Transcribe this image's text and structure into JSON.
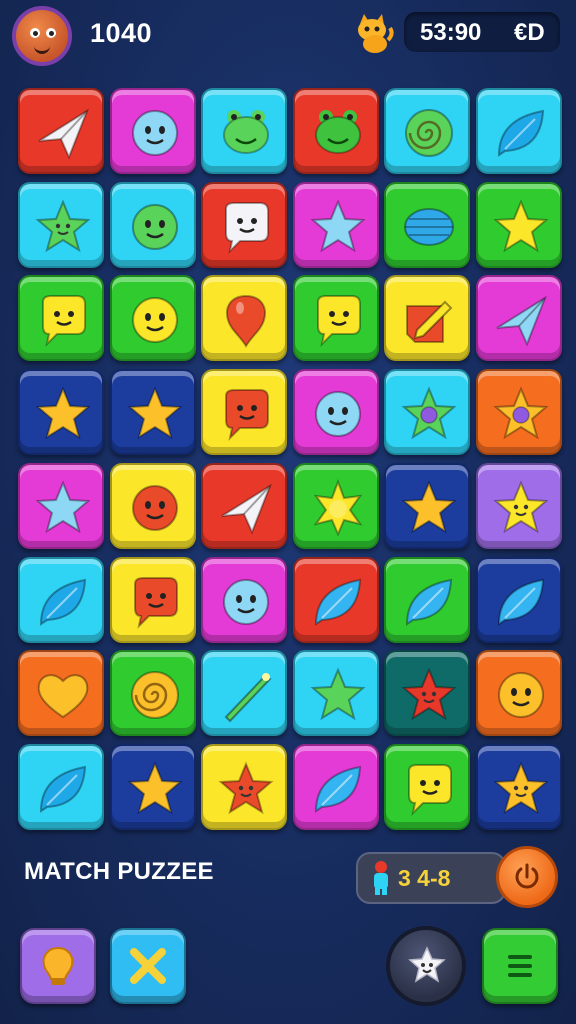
{
  "hud": {
    "score": "1040",
    "timer": "53:90",
    "currency": "€D"
  },
  "footer": {
    "title": "MATCH PUZZEE",
    "level_text": "3 4-8"
  },
  "colors": {
    "red": "#e8382a",
    "magenta": "#e43ad6",
    "cyan": "#2fd3f3",
    "green": "#2fcb2f",
    "yellow": "#fbe62a",
    "navy": "#1c3d9e",
    "orange": "#f56d1f",
    "purple": "#9f6de8",
    "teal": "#0e6b68"
  },
  "board": {
    "rows": [
      [
        {
          "color": "red",
          "icon": "paper-plane-icon"
        },
        {
          "color": "magenta",
          "icon": "smiley-blob-icon"
        },
        {
          "color": "cyan",
          "icon": "frog-icon"
        },
        {
          "color": "red",
          "icon": "frog-icon"
        },
        {
          "color": "cyan",
          "icon": "swirl-icon"
        },
        {
          "color": "cyan",
          "icon": "leaf-drop-icon"
        }
      ],
      [
        {
          "color": "cyan",
          "icon": "star-face-icon"
        },
        {
          "color": "cyan",
          "icon": "smiley-blob-icon"
        },
        {
          "color": "red",
          "icon": "speech-face-icon"
        },
        {
          "color": "magenta",
          "icon": "star-icon"
        },
        {
          "color": "green",
          "icon": "ball-icon"
        },
        {
          "color": "green",
          "icon": "star-icon"
        }
      ],
      [
        {
          "color": "green",
          "icon": "speech-face-icon"
        },
        {
          "color": "green",
          "icon": "smiley-blob-icon"
        },
        {
          "color": "yellow",
          "icon": "balloon-icon"
        },
        {
          "color": "green",
          "icon": "speech-face-icon"
        },
        {
          "color": "yellow",
          "icon": "pencil-icon"
        },
        {
          "color": "magenta",
          "icon": "paper-plane-icon"
        }
      ],
      [
        {
          "color": "navy",
          "icon": "star-icon"
        },
        {
          "color": "navy",
          "icon": "star-icon"
        },
        {
          "color": "yellow",
          "icon": "speech-face-icon"
        },
        {
          "color": "magenta",
          "icon": "smiley-blob-icon"
        },
        {
          "color": "cyan",
          "icon": "star-gem-icon"
        },
        {
          "color": "orange",
          "icon": "star-gem-icon"
        }
      ],
      [
        {
          "color": "magenta",
          "icon": "star-icon"
        },
        {
          "color": "yellow",
          "icon": "smiley-blob-icon"
        },
        {
          "color": "red",
          "icon": "paper-plane-icon"
        },
        {
          "color": "green",
          "icon": "sun-star-icon"
        },
        {
          "color": "navy",
          "icon": "star-icon"
        },
        {
          "color": "purple",
          "icon": "star-face-icon"
        }
      ],
      [
        {
          "color": "cyan",
          "icon": "leaf-drop-icon"
        },
        {
          "color": "yellow",
          "icon": "speech-face-icon"
        },
        {
          "color": "magenta",
          "icon": "smiley-blob-icon"
        },
        {
          "color": "red",
          "icon": "leaf-drop-icon"
        },
        {
          "color": "green",
          "icon": "leaf-drop-icon"
        },
        {
          "color": "navy",
          "icon": "leaf-drop-icon"
        }
      ],
      [
        {
          "color": "orange",
          "icon": "heart-icon"
        },
        {
          "color": "green",
          "icon": "swirl-icon"
        },
        {
          "color": "cyan",
          "icon": "wand-icon"
        },
        {
          "color": "cyan",
          "icon": "star-icon"
        },
        {
          "color": "teal",
          "icon": "star-face-icon"
        },
        {
          "color": "orange",
          "icon": "smiley-blob-icon"
        }
      ],
      [
        {
          "color": "cyan",
          "icon": "leaf-drop-icon"
        },
        {
          "color": "navy",
          "icon": "star-icon"
        },
        {
          "color": "yellow",
          "icon": "star-face-icon"
        },
        {
          "color": "magenta",
          "icon": "leaf-drop-icon"
        },
        {
          "color": "green",
          "icon": "speech-face-icon"
        },
        {
          "color": "navy",
          "icon": "star-face-icon"
        }
      ]
    ]
  },
  "bottom_buttons": [
    {
      "name": "hint-button",
      "icon": "bulb-icon",
      "color": "purple"
    },
    {
      "name": "shuffle-button",
      "icon": "cross-icon",
      "color": "cyan"
    },
    {
      "name": "character-button",
      "icon": "star-face-icon",
      "color": "dark"
    },
    {
      "name": "menu-button",
      "icon": "menu-icon",
      "color": "green"
    }
  ]
}
